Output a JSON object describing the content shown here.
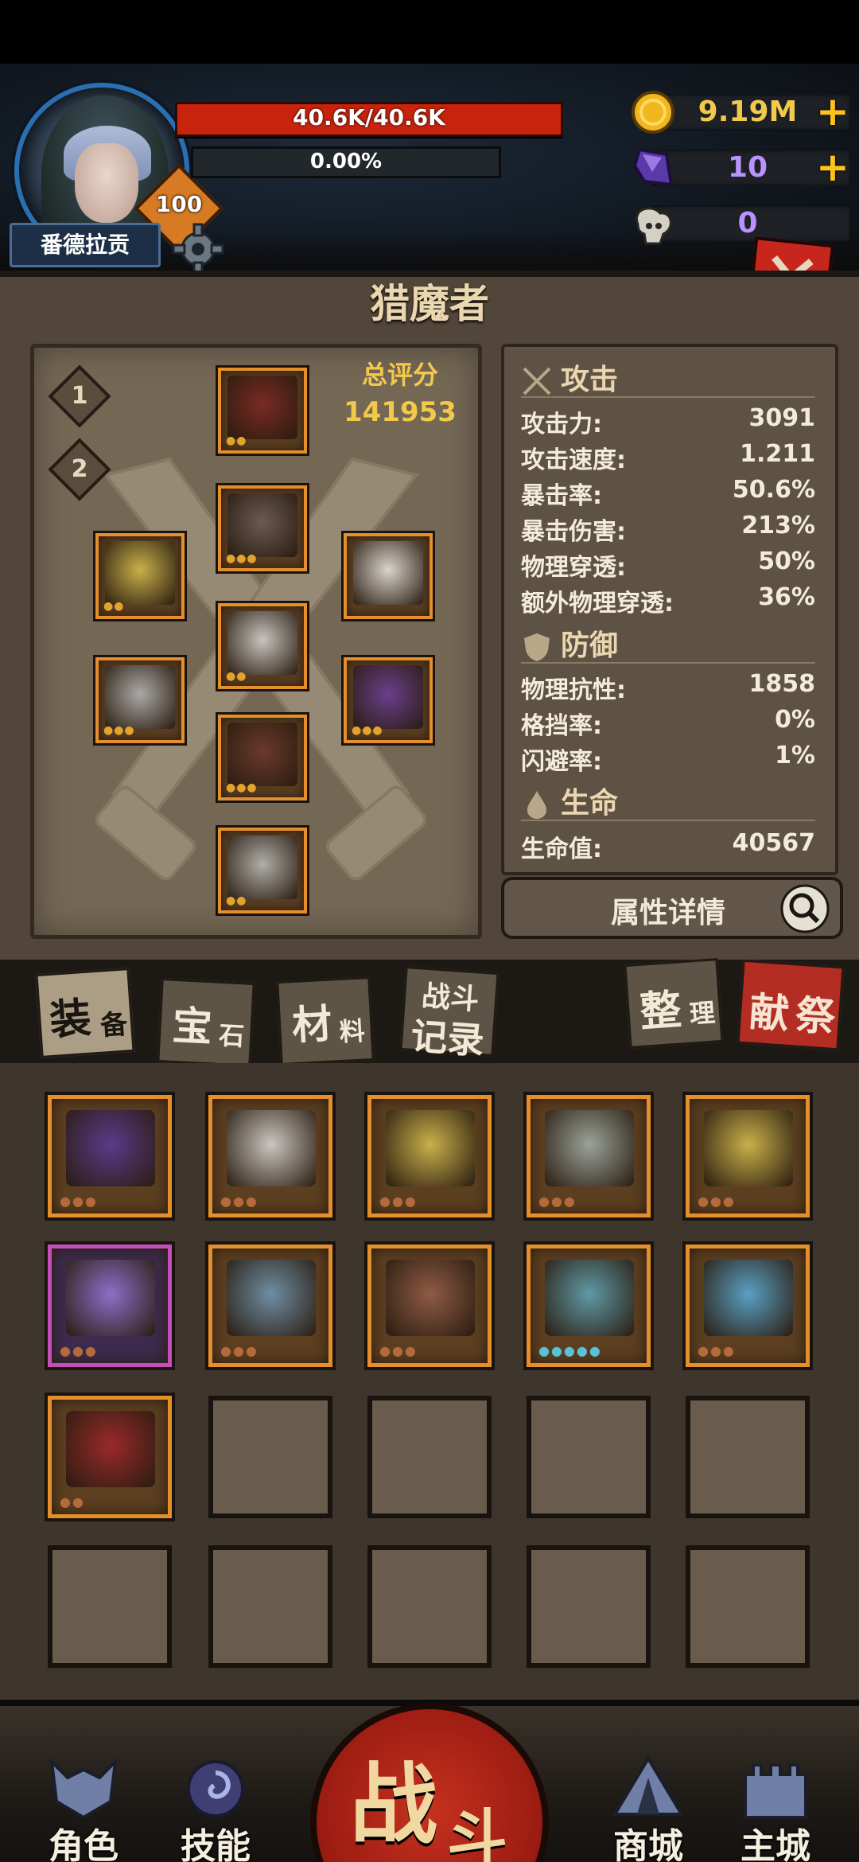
{
  "hero": {
    "name": "番德拉贡",
    "level": "100",
    "hp_text": "40.6K/40.6K",
    "xp_text": "0.00%",
    "xp_progress": 0.0,
    "hp_progress": 1.0
  },
  "currencies": [
    {
      "icon": "gold-coin-icon",
      "value": "9.19M",
      "color": "#f2c94a",
      "has_plus": true,
      "plus": "+"
    },
    {
      "icon": "purple-crystal-icon",
      "value": "10",
      "color": "#b892ff",
      "has_plus": true,
      "plus": "+"
    },
    {
      "icon": "ram-skull-icon",
      "value": "0",
      "color": "#b892ff",
      "has_plus": false,
      "plus": ""
    }
  ],
  "close_label": "✕",
  "panel": {
    "title": "猎魔者",
    "score_label": "总评分",
    "score_value": "141953",
    "loadouts": [
      "1",
      "2"
    ]
  },
  "equipment_slots": [
    {
      "name": "helmet",
      "color": "#7a2a23"
    },
    {
      "name": "armor",
      "color": "#6b5a53"
    },
    {
      "name": "ring",
      "color": "#c9b04a"
    },
    {
      "name": "necklace",
      "color": "#d9d4cc"
    },
    {
      "name": "belt",
      "color": "#c7c4be"
    },
    {
      "name": "main-weapon",
      "color": "#aaa9a6"
    },
    {
      "name": "off-weapon",
      "color": "#6b3f8e"
    },
    {
      "name": "pants",
      "color": "#6a3a2c"
    },
    {
      "name": "boots",
      "color": "#b0aea9"
    }
  ],
  "stats": {
    "attack_header": "攻击",
    "attack": [
      {
        "k": "攻击力:",
        "v": "3091"
      },
      {
        "k": "攻击速度:",
        "v": "1.211"
      },
      {
        "k": "暴击率:",
        "v": "50.6%"
      },
      {
        "k": "暴击伤害:",
        "v": "213%"
      },
      {
        "k": "物理穿透:",
        "v": "50%"
      },
      {
        "k": "额外物理穿透:",
        "v": "36%"
      }
    ],
    "defense_header": "防御",
    "defense": [
      {
        "k": "物理抗性:",
        "v": "1858"
      },
      {
        "k": "格挡率:",
        "v": "0%"
      },
      {
        "k": "闪避率:",
        "v": "1%"
      }
    ],
    "life_header": "生命",
    "life": [
      {
        "k": "生命值:",
        "v": "40567"
      }
    ],
    "detail_button": "属性详情"
  },
  "tabs": [
    {
      "top": "装",
      "bottom": "备",
      "active": true
    },
    {
      "top": "宝",
      "bottom": "石",
      "active": false
    },
    {
      "top": "材",
      "bottom": "料",
      "active": false
    },
    {
      "top": "战斗",
      "bottom": "记录",
      "active": false
    },
    {
      "top": "整",
      "bottom": "理",
      "active": false
    },
    {
      "top": "献",
      "bottom": "祭",
      "active": false
    }
  ],
  "inventory": [
    {
      "name": "dark-greatsword",
      "color": "#5b3a8a",
      "rare": false
    },
    {
      "name": "steel-greaves",
      "color": "#c9c6c0",
      "rare": false
    },
    {
      "name": "gold-ring",
      "color": "#c9b04a",
      "rare": false
    },
    {
      "name": "serpent-blade",
      "color": "#9aa39a",
      "rare": false
    },
    {
      "name": "gold-ring-2",
      "color": "#c9b04a",
      "rare": false
    },
    {
      "name": "arcane-staff",
      "color": "#8d6fc9",
      "rare": true
    },
    {
      "name": "frost-sword",
      "color": "#6f8ea4",
      "rare": false
    },
    {
      "name": "bronze-blade",
      "color": "#8f5b45",
      "rare": false
    },
    {
      "name": "frost-hammer",
      "color": "#5f9aa6",
      "rare": false
    },
    {
      "name": "ice-scythe",
      "color": "#5aa0c4",
      "rare": false
    },
    {
      "name": "rose-spear",
      "color": "#9a2a2a",
      "rare": false
    }
  ],
  "nav": {
    "role": "角色",
    "skill": "技能",
    "battle_top": "战",
    "battle_bottom": "斗",
    "shop": "商城",
    "castle": "主城"
  }
}
